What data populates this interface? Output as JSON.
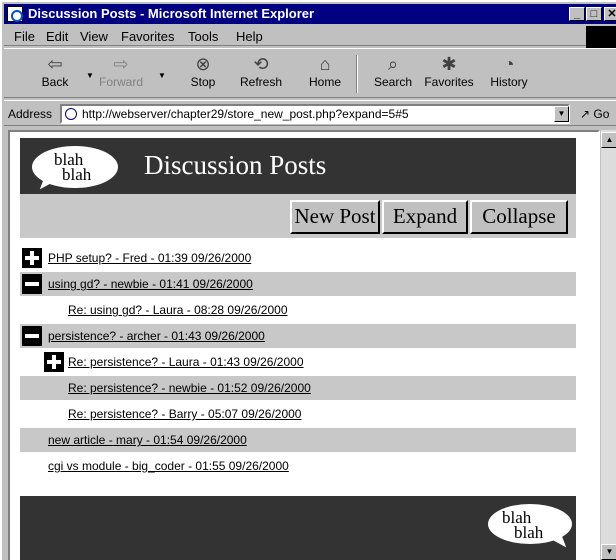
{
  "window": {
    "title": "Discussion Posts - Microsoft Internet Explorer",
    "min_label": "_",
    "max_label": "□",
    "close_label": "✕"
  },
  "menu": [
    "File",
    "Edit",
    "View",
    "Favorites",
    "Tools",
    "Help"
  ],
  "toolbar": {
    "back": "Back",
    "forward": "Forward",
    "stop": "Stop",
    "refresh": "Refresh",
    "home": "Home",
    "search": "Search",
    "favorites": "Favorites",
    "history": "History"
  },
  "address": {
    "label": "Address",
    "url": "http://webserver/chapter29/store_new_post.php?expand=5#5",
    "go": "Go"
  },
  "page": {
    "logo_line1": "blah",
    "logo_line2": "blah",
    "title": "Discussion Posts",
    "buttons": {
      "new_post": "New Post",
      "expand": "Expand",
      "collapse": "Collapse"
    },
    "posts": [
      "PHP setup? - Fred - 01:39 09/26/2000",
      "using gd? - newbie - 01:41 09/26/2000",
      "Re: using gd? - Laura - 08:28 09/26/2000",
      "persistence? - archer - 01:43 09/26/2000",
      "Re: persistence? - Laura - 01:43 09/26/2000",
      "Re: persistence? - newbie - 01:52 09/26/2000",
      "Re: persistence? - Barry - 05:07 09/26/2000",
      "new article - mary - 01:54 09/26/2000",
      "cgi vs module - big_coder - 01:55 09/26/2000"
    ]
  }
}
